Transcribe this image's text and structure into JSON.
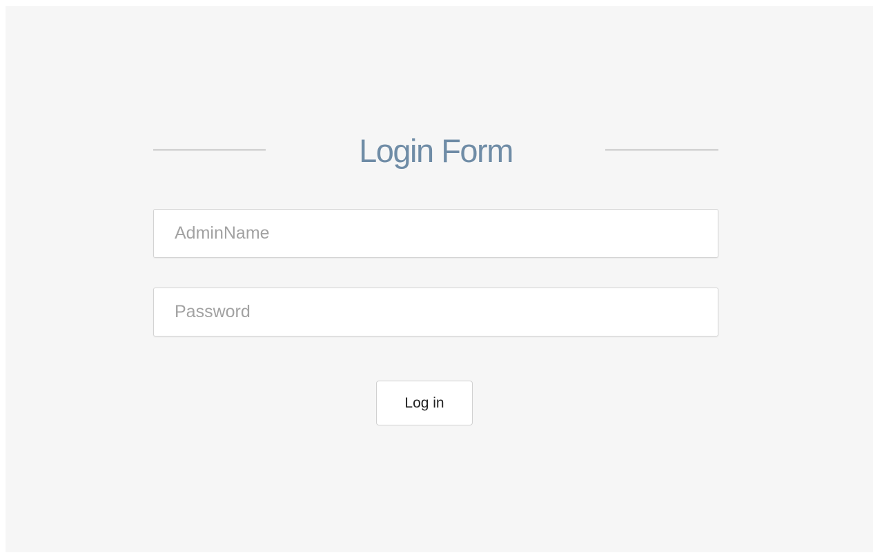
{
  "login_form": {
    "title": "Login Form",
    "username_placeholder": "AdminName",
    "password_placeholder": "Password",
    "submit_label": "Log in"
  },
  "colors": {
    "page_background": "#f6f6f6",
    "title": "#6f8ca6",
    "divider": "#7a7a7a",
    "input_border": "#d3d3d3"
  }
}
